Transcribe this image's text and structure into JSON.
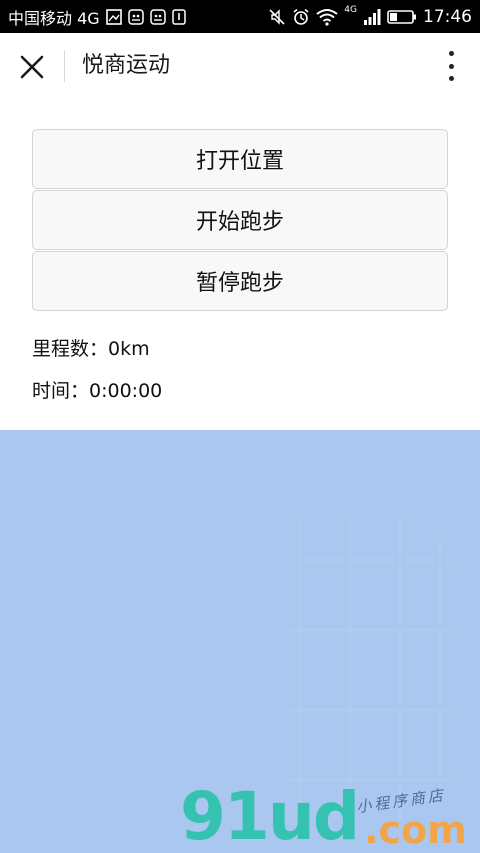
{
  "status_bar": {
    "carrier": "中国移动 4G",
    "time": "17:46",
    "network_label": "4G",
    "icons": [
      "image-icon",
      "notification-icon",
      "notification-icon",
      "sim-icon",
      "mute-icon",
      "alarm-icon",
      "wifi-icon",
      "signal-icon",
      "battery-icon"
    ]
  },
  "navbar": {
    "title": "悦商运动",
    "close_icon": "close-icon",
    "more_icon": "more-vertical-icon"
  },
  "actions": {
    "open_location": "打开位置",
    "start_run": "开始跑步",
    "pause_run": "暂停跑步"
  },
  "stats": {
    "distance": "里程数：0km",
    "time": "时间：0:00:00"
  },
  "map": {
    "background_color": "#a9c7ef"
  },
  "watermark": {
    "main": "91ud",
    "domain": ".com",
    "tag": "小程序商店"
  }
}
